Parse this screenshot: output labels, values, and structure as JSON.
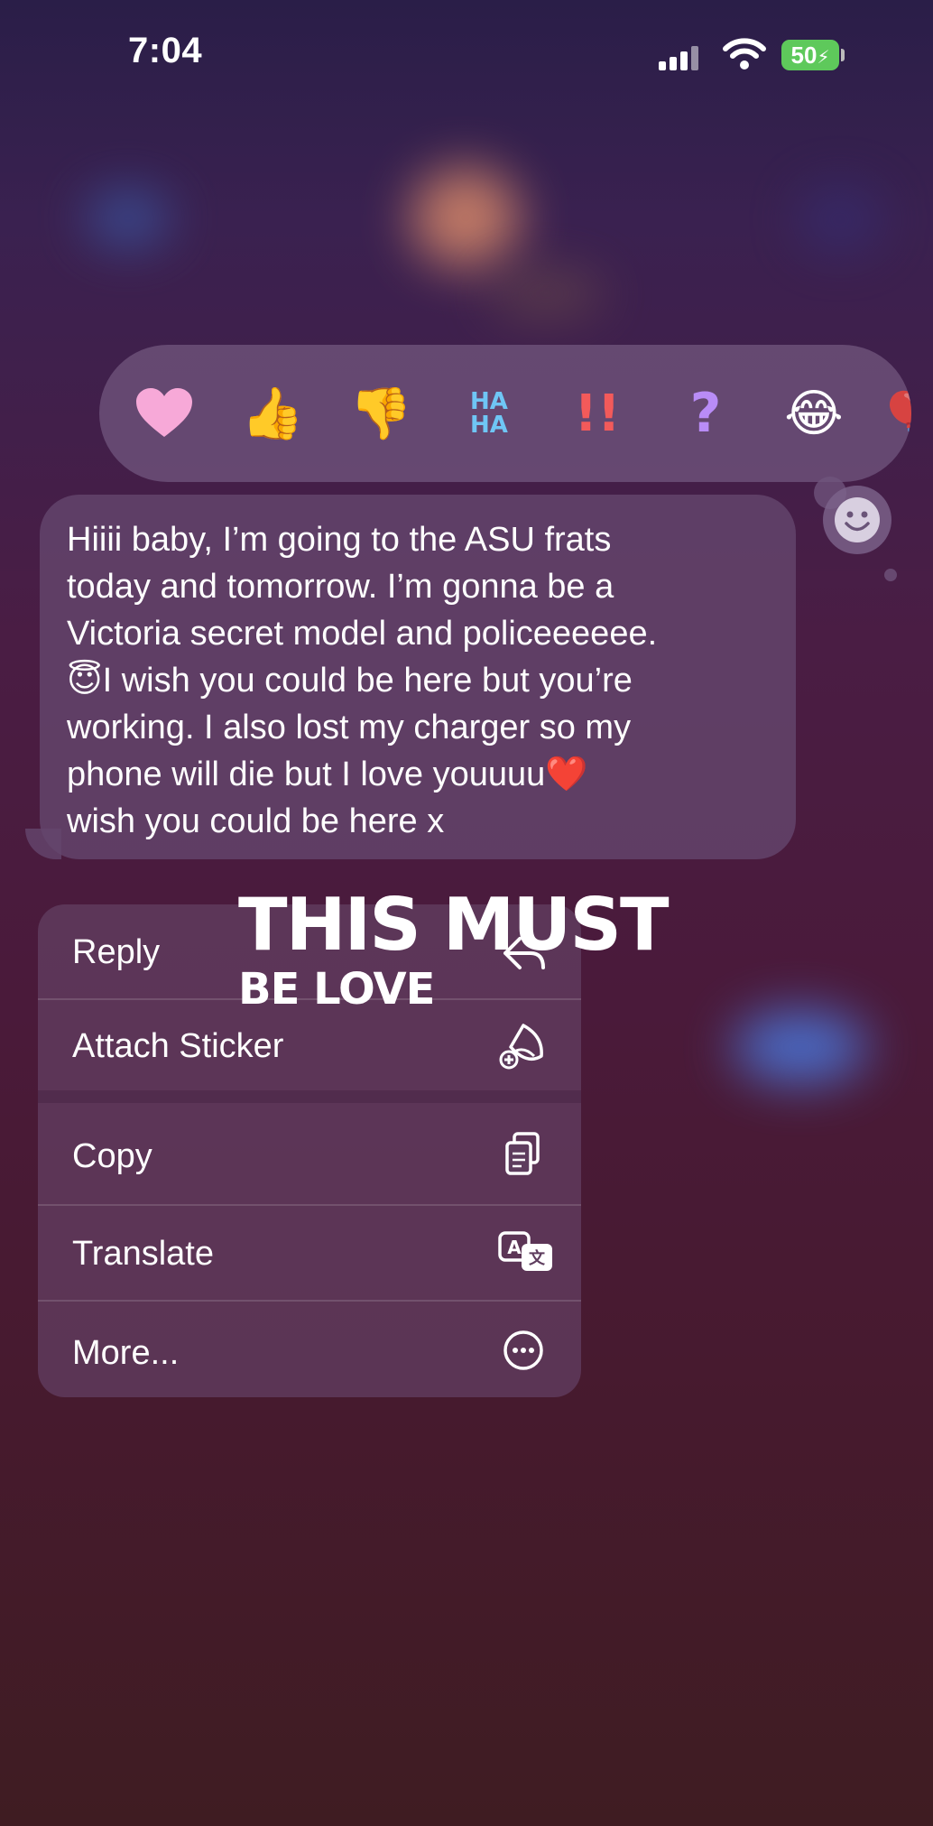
{
  "status_bar": {
    "time": "7:04",
    "battery_level": "50",
    "battery_color": "#5ec95b"
  },
  "reactions": [
    {
      "name": "heart",
      "glyph": "💗"
    },
    {
      "name": "thumbs-up",
      "glyph": "👍"
    },
    {
      "name": "thumbs-down",
      "glyph": "👎"
    },
    {
      "name": "haha",
      "glyph": "HA HA"
    },
    {
      "name": "exclamation",
      "glyph": "‼"
    },
    {
      "name": "question",
      "glyph": "?"
    },
    {
      "name": "laughing",
      "glyph": "😂"
    }
  ],
  "message": {
    "lines": [
      "Hiiii baby, I’m going to the ASU frats",
      "today and tomorrow. I’m gonna be a",
      "Victoria secret model and policeeeeee.",
      "I wish you could be here but you’re",
      "working. I also lost my charger so my",
      "phone will die but I love youuuu",
      "wish you could be here x"
    ]
  },
  "menu": {
    "items": [
      {
        "label": "Reply",
        "icon": "reply-arrow-icon"
      },
      {
        "label": "Attach Sticker",
        "icon": "sticker-icon"
      },
      {
        "label": "Copy",
        "icon": "copy-icon"
      },
      {
        "label": "Translate",
        "icon": "translate-icon"
      },
      {
        "label": "More...",
        "icon": "more-icon"
      }
    ]
  },
  "overlay": {
    "line1": "THIS MUST",
    "line2": "BE LOVE"
  }
}
